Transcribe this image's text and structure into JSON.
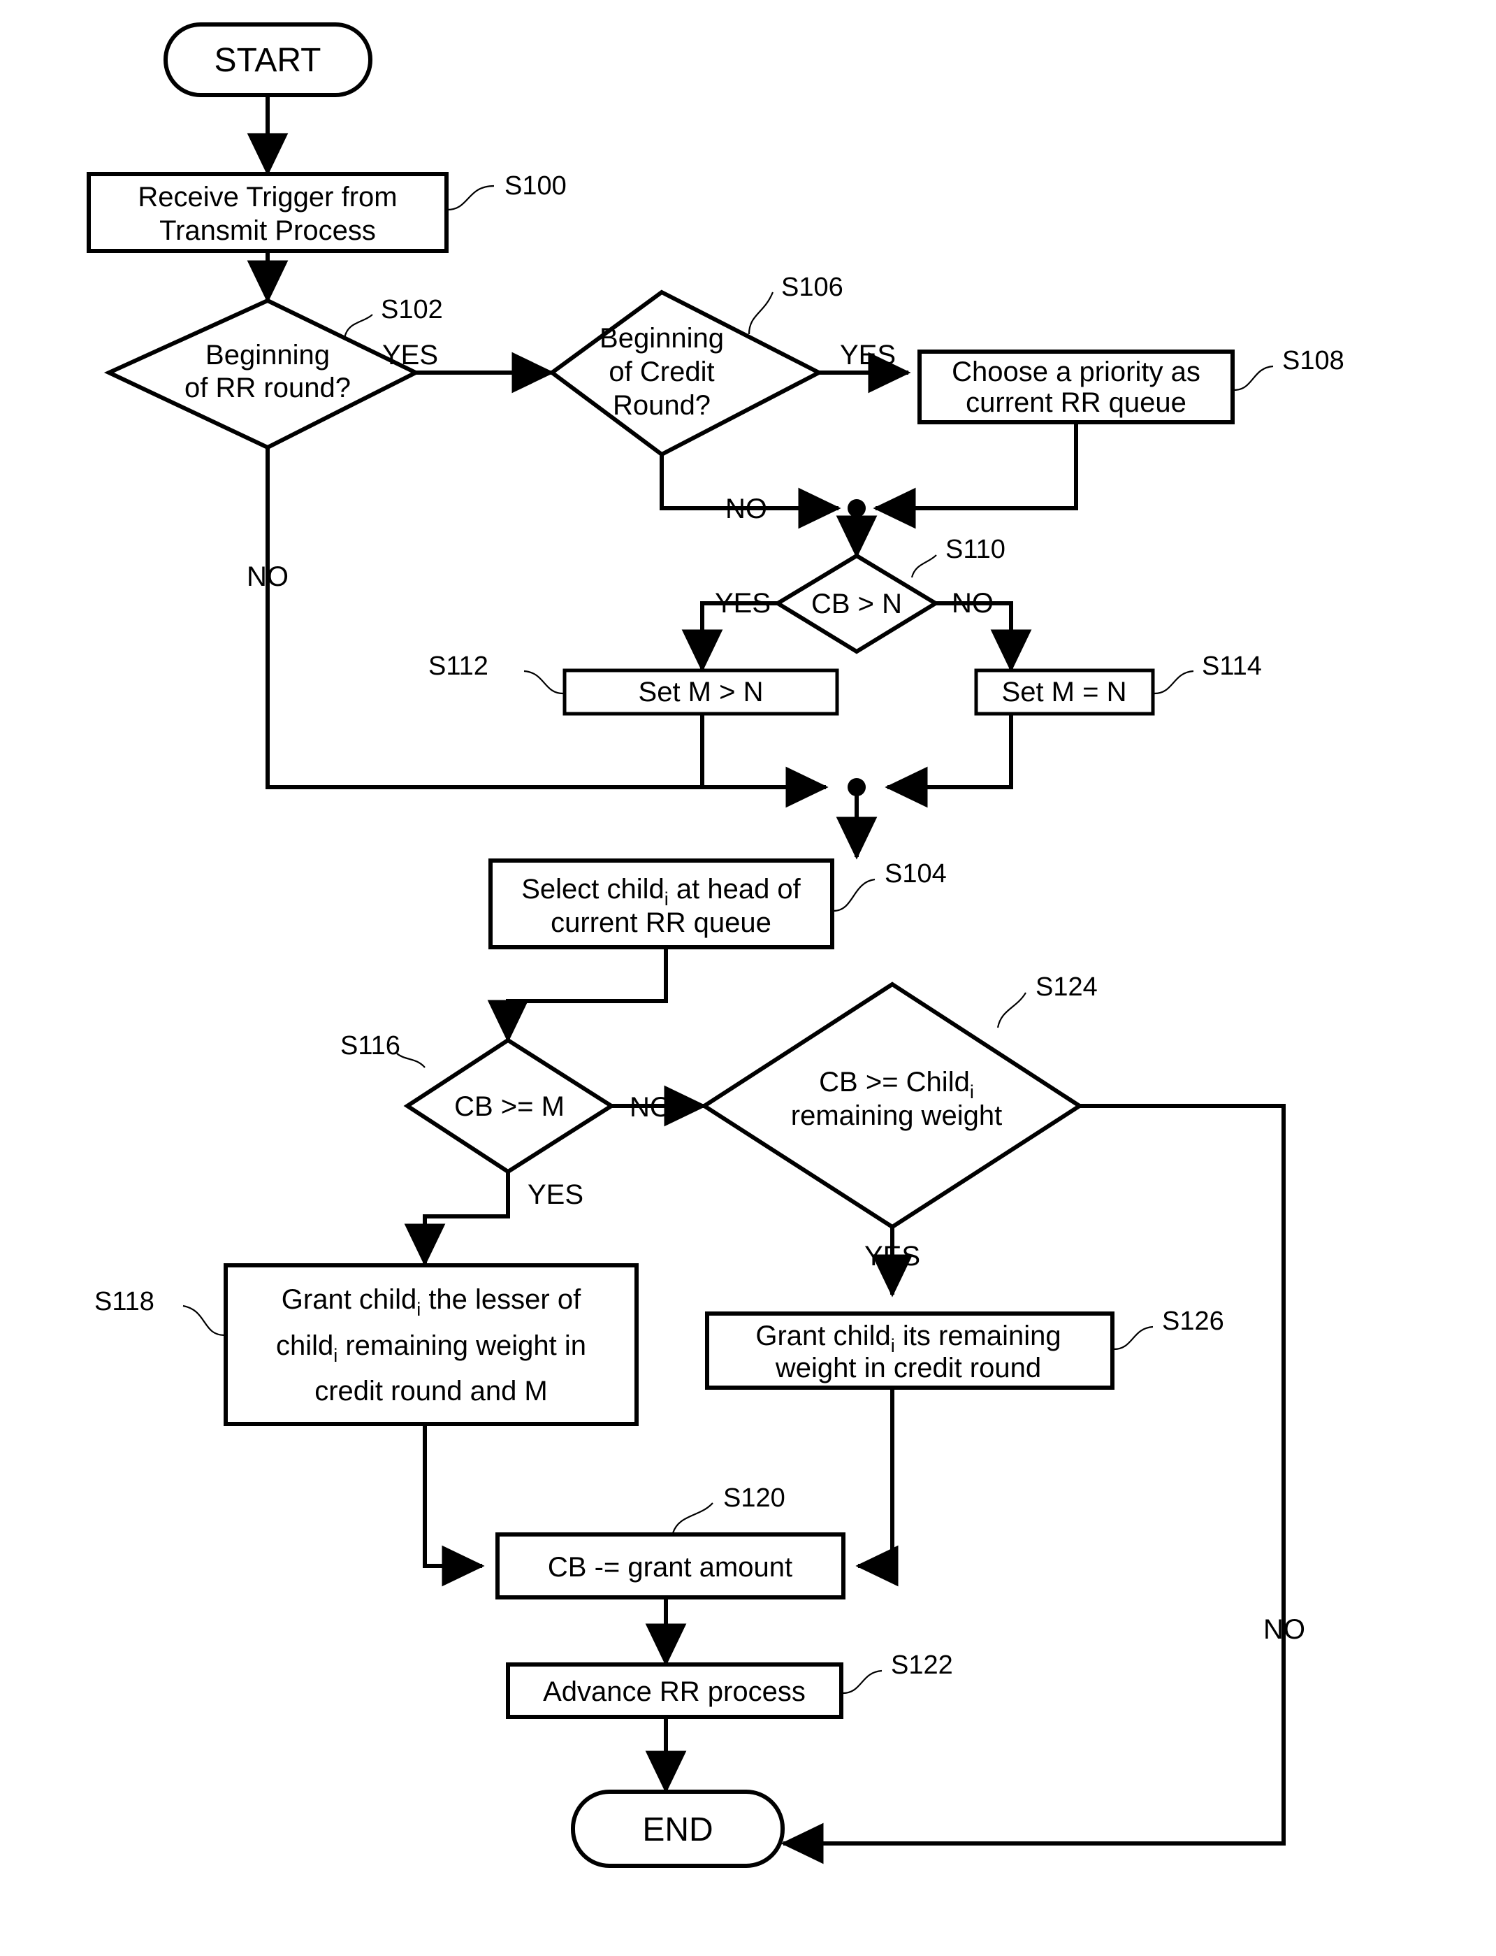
{
  "diagram": {
    "type": "flowchart",
    "title": "",
    "orientation": "top-to-bottom"
  },
  "nodes": {
    "start": {
      "label": "START",
      "shape": "terminal"
    },
    "s100": {
      "ref": "S100",
      "line1": "Receive Trigger from",
      "line2": "Transmit Process",
      "shape": "process"
    },
    "s102": {
      "ref": "S102",
      "line1": "Beginning",
      "line2": "of RR round?",
      "shape": "decision"
    },
    "s106": {
      "ref": "S106",
      "line1": "Beginning",
      "line2": "of Credit",
      "line3": "Round?",
      "shape": "decision"
    },
    "s108": {
      "ref": "S108",
      "line1": "Choose a priority as",
      "line2": "current RR queue",
      "shape": "process"
    },
    "s110": {
      "ref": "S110",
      "line1": "CB > N",
      "shape": "decision"
    },
    "s112": {
      "ref": "S112",
      "line1": "Set M > N",
      "shape": "process"
    },
    "s114": {
      "ref": "S114",
      "line1": "Set M = N",
      "shape": "process"
    },
    "s104": {
      "ref": "S104",
      "line1_a": "Select child",
      "line1_sub": "i",
      "line1_b": " at head of",
      "line2": "current RR queue",
      "shape": "process"
    },
    "s116": {
      "ref": "S116",
      "line1": "CB >= M",
      "shape": "decision"
    },
    "s124": {
      "ref": "S124",
      "line1_a": "CB >= Child",
      "line1_sub": "i",
      "line2": "remaining weight",
      "shape": "decision"
    },
    "s118": {
      "ref": "S118",
      "line1_a": "Grant child",
      "line1_sub": "i",
      "line1_b": " the lesser of",
      "line2_a": "child",
      "line2_sub": "i",
      "line2_b": "  remaining weight in",
      "line3": "credit round and M",
      "shape": "process"
    },
    "s126": {
      "ref": "S126",
      "line1_a": "Grant child",
      "line1_sub": "i",
      "line1_b": " its remaining",
      "line2": "weight in credit round",
      "shape": "process"
    },
    "s120": {
      "ref": "S120",
      "line1": "CB -= grant amount",
      "shape": "process"
    },
    "s122": {
      "ref": "S122",
      "line1": "Advance RR process",
      "shape": "process"
    },
    "end": {
      "label": "END",
      "shape": "terminal"
    }
  },
  "edge_labels": {
    "s102_yes": "YES",
    "s102_no": "NO",
    "s106_yes": "YES",
    "s106_no": "NO",
    "s110_yes": "YES",
    "s110_no": "NO",
    "s116_yes": "YES",
    "s116_no": "NO",
    "s124_yes": "YES",
    "s124_no": "NO"
  },
  "colors": {
    "stroke": "#000000",
    "fill": "#ffffff",
    "text": "#000000"
  }
}
